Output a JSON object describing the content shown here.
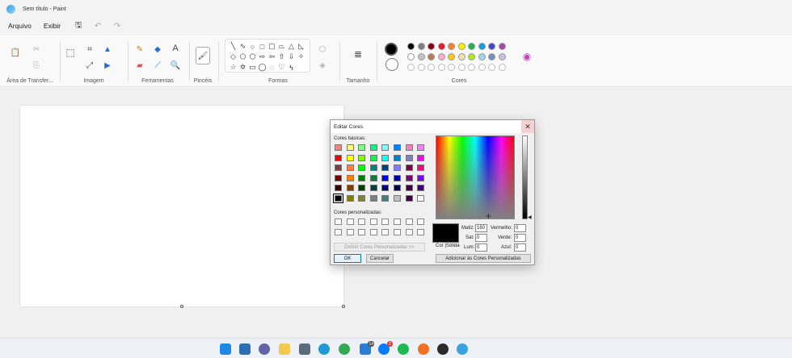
{
  "window": {
    "title": "Sem título - Paint"
  },
  "menu": {
    "items": [
      "Arquivo",
      "Exibir"
    ]
  },
  "ribbon": {
    "groups": {
      "clipboard": "Área de Transfer...",
      "image": "Imagem",
      "tools": "Ferramentas",
      "brushes": "Pincéis",
      "shapes": "Formas",
      "size": "Tamanho",
      "colors": "Cores"
    },
    "text_tool": "A",
    "palette": [
      "#000000",
      "#7f7f7f",
      "#880015",
      "#ed1c24",
      "#ff7f27",
      "#fff200",
      "#22b14c",
      "#00a2e8",
      "#3f48cc",
      "#a349a4",
      "#ffffff",
      "#c3c3c3",
      "#b97a57",
      "#ffaec9",
      "#ffc90e",
      "#efe4b0",
      "#b5e61d",
      "#99d9ea",
      "#7092be",
      "#c8bfe7"
    ],
    "color1": "#000000",
    "color2": "#ffffff"
  },
  "dialog": {
    "title": "Editar Cores",
    "close": "✕",
    "basic_label": "Cores básicas:",
    "custom_label": "Cores personalizadas:",
    "define_button": "Definir Cores Personalizadas >>",
    "ok": "OK",
    "cancel": "Cancelar",
    "add_button": "Adicionar às Cores Personalizadas",
    "color_solid": "Cor",
    "solid": "|Sólida",
    "fields": {
      "hue_label": "Matiz:",
      "hue": "160",
      "sat_label": "Sat:",
      "sat": "0",
      "lum_label": "Lum:",
      "lum": "0",
      "red_label": "Vermelho:",
      "red": "0",
      "green_label": "Verde:",
      "green": "0",
      "blue_label": "Azul:",
      "blue": "0"
    },
    "basic_colors": [
      "#ff8080",
      "#ffff80",
      "#80ff80",
      "#00ff80",
      "#80ffff",
      "#0080ff",
      "#ff80c0",
      "#ff80ff",
      "#ff0000",
      "#ffff00",
      "#80ff00",
      "#00ff40",
      "#00ffff",
      "#0080c0",
      "#8080c0",
      "#ff00ff",
      "#804040",
      "#ff8040",
      "#00ff00",
      "#008080",
      "#004080",
      "#8080ff",
      "#800040",
      "#ff0080",
      "#800000",
      "#ff8000",
      "#008000",
      "#008040",
      "#0000ff",
      "#0000a0",
      "#800080",
      "#8000ff",
      "#400000",
      "#804000",
      "#004000",
      "#004040",
      "#000080",
      "#000040",
      "#400040",
      "#400080",
      "#000000",
      "#808000",
      "#808040",
      "#808080",
      "#408080",
      "#c0c0c0",
      "#400040",
      "#ffffff"
    ]
  },
  "taskbar": {
    "icons": [
      "start-icon",
      "widgets-icon",
      "chat-icon",
      "file-explorer-icon",
      "calculator-icon",
      "edge-icon",
      "chrome-icon",
      "store-icon",
      "messenger-icon",
      "spotify-icon",
      "podcast-icon",
      "obs-icon",
      "paint-icon"
    ],
    "badges": {
      "store": "14",
      "messenger": "2"
    }
  }
}
